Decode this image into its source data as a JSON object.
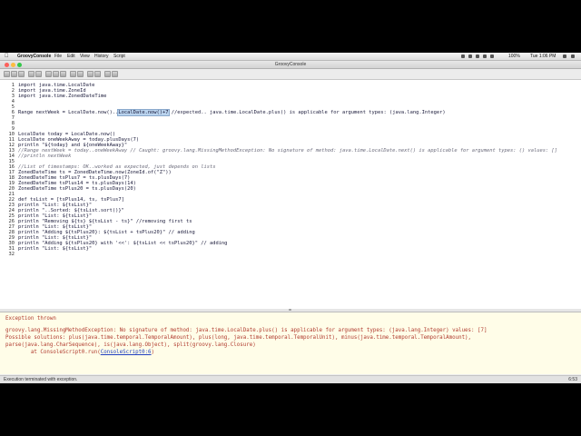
{
  "menubar": {
    "app_name": "GroovyConsole",
    "items": [
      "File",
      "Edit",
      "View",
      "History",
      "Script"
    ],
    "clock": "Tue 1:06 PM",
    "battery": "100%"
  },
  "window": {
    "title": "GroovyConsole"
  },
  "editor": {
    "lines": [
      {
        "n": "1",
        "text": "import java.time.LocalDate",
        "comment": false
      },
      {
        "n": "2",
        "text": "import java.time.ZoneId",
        "comment": false
      },
      {
        "n": "3",
        "text": "import java.time.ZonedDateTime",
        "comment": false
      },
      {
        "n": "4",
        "text": "",
        "comment": false
      },
      {
        "n": "5",
        "text": "",
        "comment": false
      },
      {
        "n": "6",
        "text": "Range nextWeek = LocalDate.now()..LocalDate.now()+7 //expected.. java.time.LocalDate.plus() is applicable for argument types: (java.lang.Integer)",
        "comment": false
      },
      {
        "n": "7",
        "text": "",
        "comment": false
      },
      {
        "n": "8",
        "text": "",
        "comment": false
      },
      {
        "n": "9",
        "text": "",
        "comment": false
      },
      {
        "n": "10",
        "text": "LocalDate today = LocalDate.now()",
        "comment": false
      },
      {
        "n": "11",
        "text": "LocalDate oneWeekAway = today.plusDays(7)",
        "comment": false
      },
      {
        "n": "12",
        "text": "println \"${today} and ${oneWeekAway}\"",
        "comment": false
      },
      {
        "n": "13",
        "text": "//Range nextWeek = today..oneWeekAway // Caught: groovy.lang.MissingMethodException: No signature of method: java.time.LocalDate.next() is applicable for argument types: () values: []",
        "comment": true
      },
      {
        "n": "14",
        "text": "//println nextWeek",
        "comment": true
      },
      {
        "n": "15",
        "text": "",
        "comment": false
      },
      {
        "n": "16",
        "text": "//List of timestamps: OK..worked as expected, just depends on lists",
        "comment": true
      },
      {
        "n": "17",
        "text": "ZonedDateTime ts = ZonedDateTime.now(ZoneId.of(\"Z\"))",
        "comment": false
      },
      {
        "n": "18",
        "text": "ZonedDateTime tsPlus7 = ts.plusDays(7)",
        "comment": false
      },
      {
        "n": "19",
        "text": "ZonedDateTime tsPlus14 = ts.plusDays(14)",
        "comment": false
      },
      {
        "n": "20",
        "text": "ZonedDateTime tsPlus20 = ts.plusDays(20)",
        "comment": false
      },
      {
        "n": "21",
        "text": "",
        "comment": false
      },
      {
        "n": "22",
        "text": "def tsList = [tsPlus14, ts, tsPlus7]",
        "comment": false
      },
      {
        "n": "23",
        "text": "println \"List: ${tsList}\"",
        "comment": false
      },
      {
        "n": "24",
        "text": "println \"..Sorted: ${tsList.sort()}\"",
        "comment": false
      },
      {
        "n": "25",
        "text": "println \"List: ${tsList}\"",
        "comment": false
      },
      {
        "n": "26",
        "text": "println \"Removing ${ts} ${tsList - ts}\" //removing first ts",
        "comment": false
      },
      {
        "n": "27",
        "text": "println \"List: ${tsList}\"",
        "comment": false
      },
      {
        "n": "28",
        "text": "println \"Adding ${tsPlus20}: ${tsList + tsPlus20}\" // adding",
        "comment": false
      },
      {
        "n": "29",
        "text": "println \"List: ${tsList}\"",
        "comment": false
      },
      {
        "n": "30",
        "text": "println \"Adding ${tsPlus20} with '<<': ${tsList << tsPlus20}\" // adding",
        "comment": false
      },
      {
        "n": "31",
        "text": "println \"List: ${tsList}\"",
        "comment": false
      },
      {
        "n": "32",
        "text": "",
        "comment": false
      }
    ],
    "highlight": "LocalDate.now()+7"
  },
  "output": {
    "header": "Exception thrown",
    "lines": [
      "groovy.lang.MissingMethodException: No signature of method: java.time.LocalDate.plus() is applicable for argument types: (java.lang.Integer) values: [7]",
      "Possible solutions: plus(java.time.temporal.TemporalAmount), plus(long, java.time.temporal.TemporalUnit), minus(java.time.temporal.TemporalAmount),",
      "parse(java.lang.CharSequence), is(java.lang.Object), split(groovy.lang.Closure)"
    ],
    "trace_prefix": "        at ConsoleScript0.run(",
    "trace_link": "ConsoleScript0:6",
    "trace_suffix": ")"
  },
  "statusbar": {
    "message": "Execution terminated with exception.",
    "position": "6:53"
  },
  "colors": {
    "selection": "#b9d3ee",
    "error_text": "#b03a2e",
    "output_bg": "#fffde8"
  },
  "dock": {
    "icons": [
      "finder-icon",
      "terminal-icon",
      "chrome-icon",
      "spotify-icon",
      "launchpad-icon",
      "sublime-icon",
      "illustrator-icon",
      "photoshop-icon",
      "intellij-icon",
      "music-icon",
      "calculator-icon",
      "messages-icon",
      "network-icon",
      "twitter-icon",
      "preview-icon",
      "sketch-icon",
      "pages-icon",
      "keynote-icon",
      "settings-icon",
      "groovy-icon",
      "folder-icon",
      "trash-icon"
    ]
  }
}
